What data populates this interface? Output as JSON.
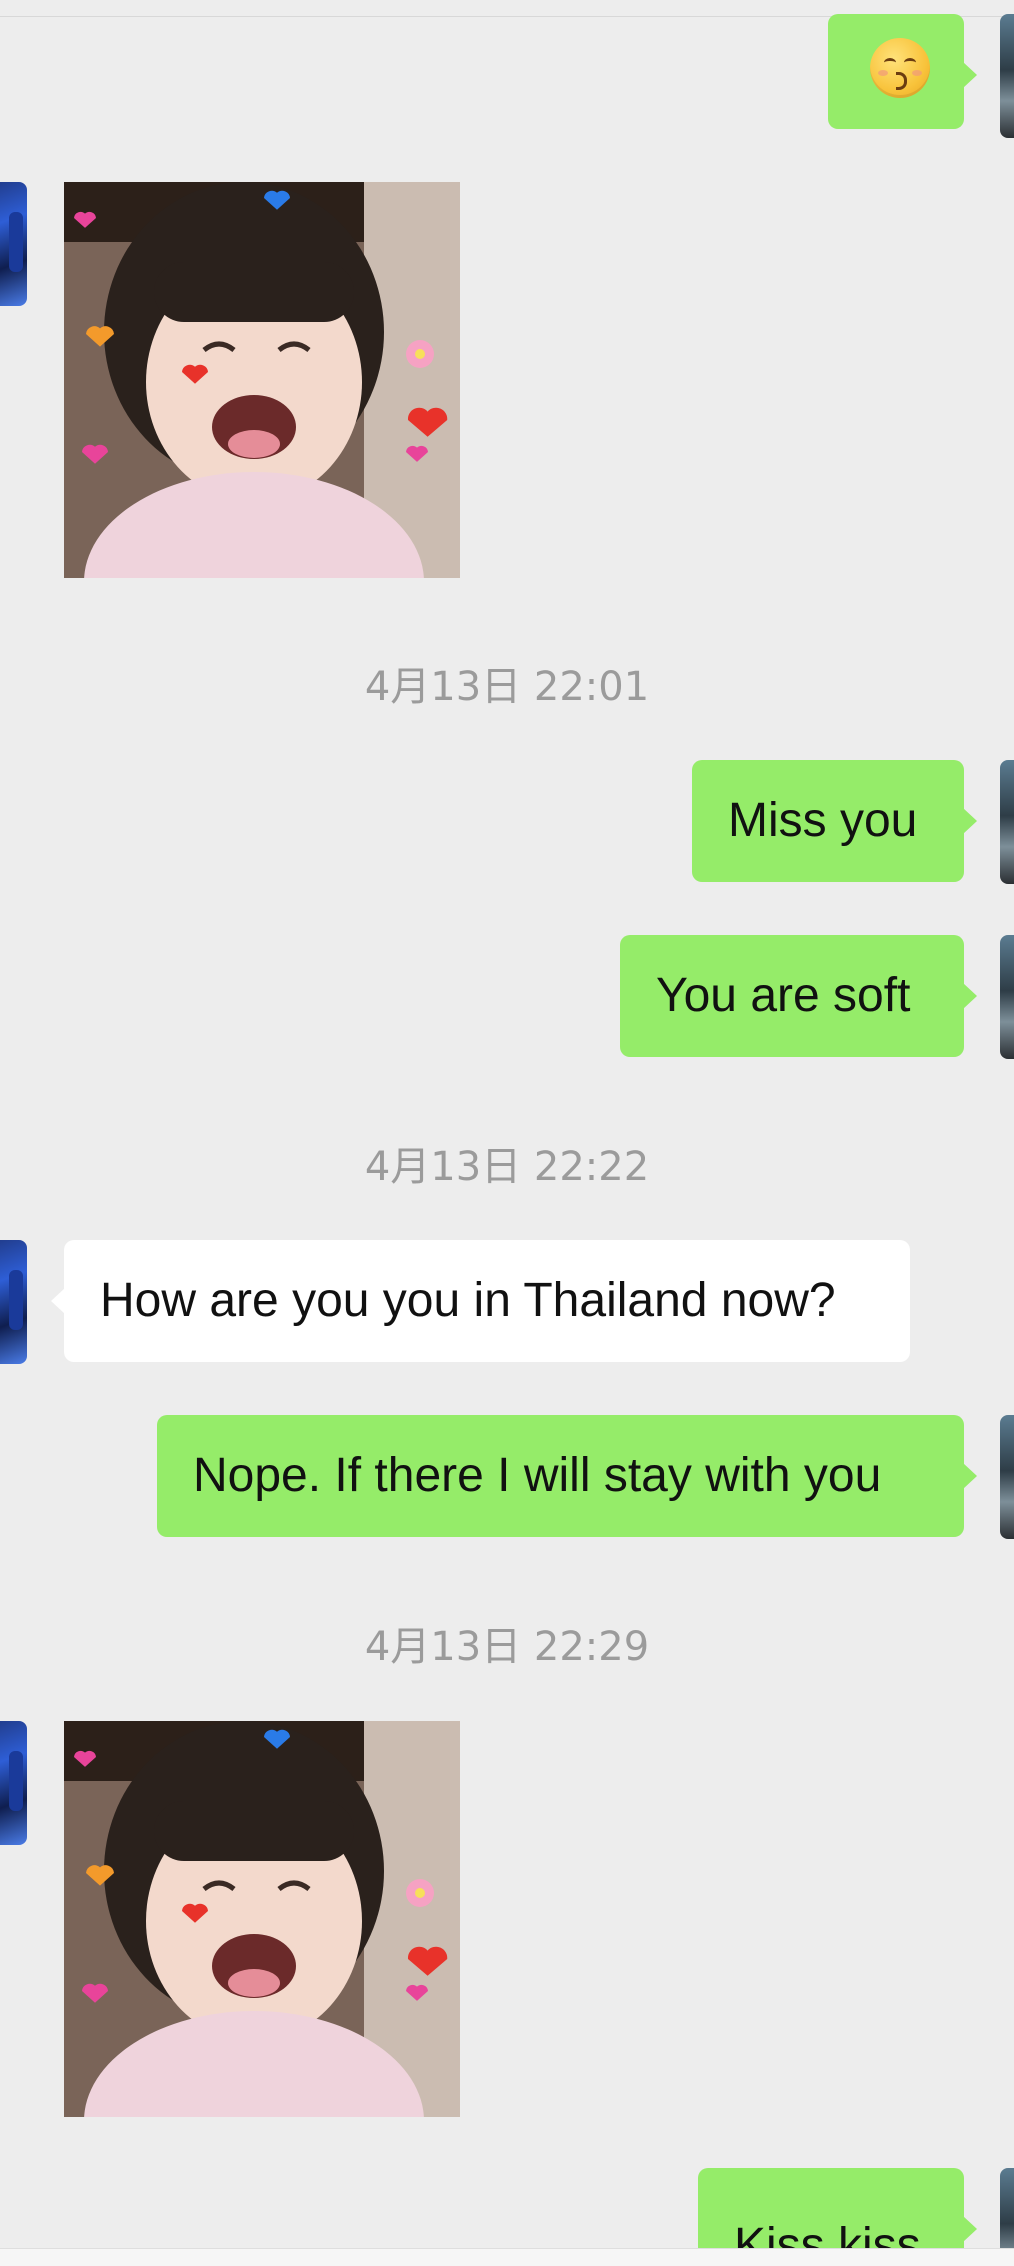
{
  "messages": [
    {
      "id": "emoji-kiss",
      "type": "emoji",
      "direction": "outgoing",
      "emoji_name": "kissing-face-with-smiling-eyes-icon"
    },
    {
      "id": "sticker-1",
      "type": "sticker",
      "direction": "incoming"
    },
    {
      "id": "ts-1",
      "type": "timestamp",
      "text": "4月13日 22:01"
    },
    {
      "id": "msg-1",
      "type": "text",
      "direction": "outgoing",
      "text": "Miss you"
    },
    {
      "id": "msg-2",
      "type": "text",
      "direction": "outgoing",
      "text": "You are soft"
    },
    {
      "id": "ts-2",
      "type": "timestamp",
      "text": "4月13日 22:22"
    },
    {
      "id": "msg-3",
      "type": "text",
      "direction": "incoming",
      "text": "How are you you in Thailand now?"
    },
    {
      "id": "msg-4",
      "type": "text",
      "direction": "outgoing",
      "text": "Nope. If there I will stay with you"
    },
    {
      "id": "ts-3",
      "type": "timestamp",
      "text": "4月13日 22:29"
    },
    {
      "id": "sticker-2",
      "type": "sticker",
      "direction": "incoming"
    },
    {
      "id": "msg-5",
      "type": "text",
      "direction": "outgoing",
      "text": "Kiss kiss"
    }
  ],
  "colors": {
    "background": "#ededed",
    "outgoing_bubble": "#95ec69",
    "incoming_bubble": "#ffffff",
    "timestamp_text": "#9b9b9b"
  }
}
